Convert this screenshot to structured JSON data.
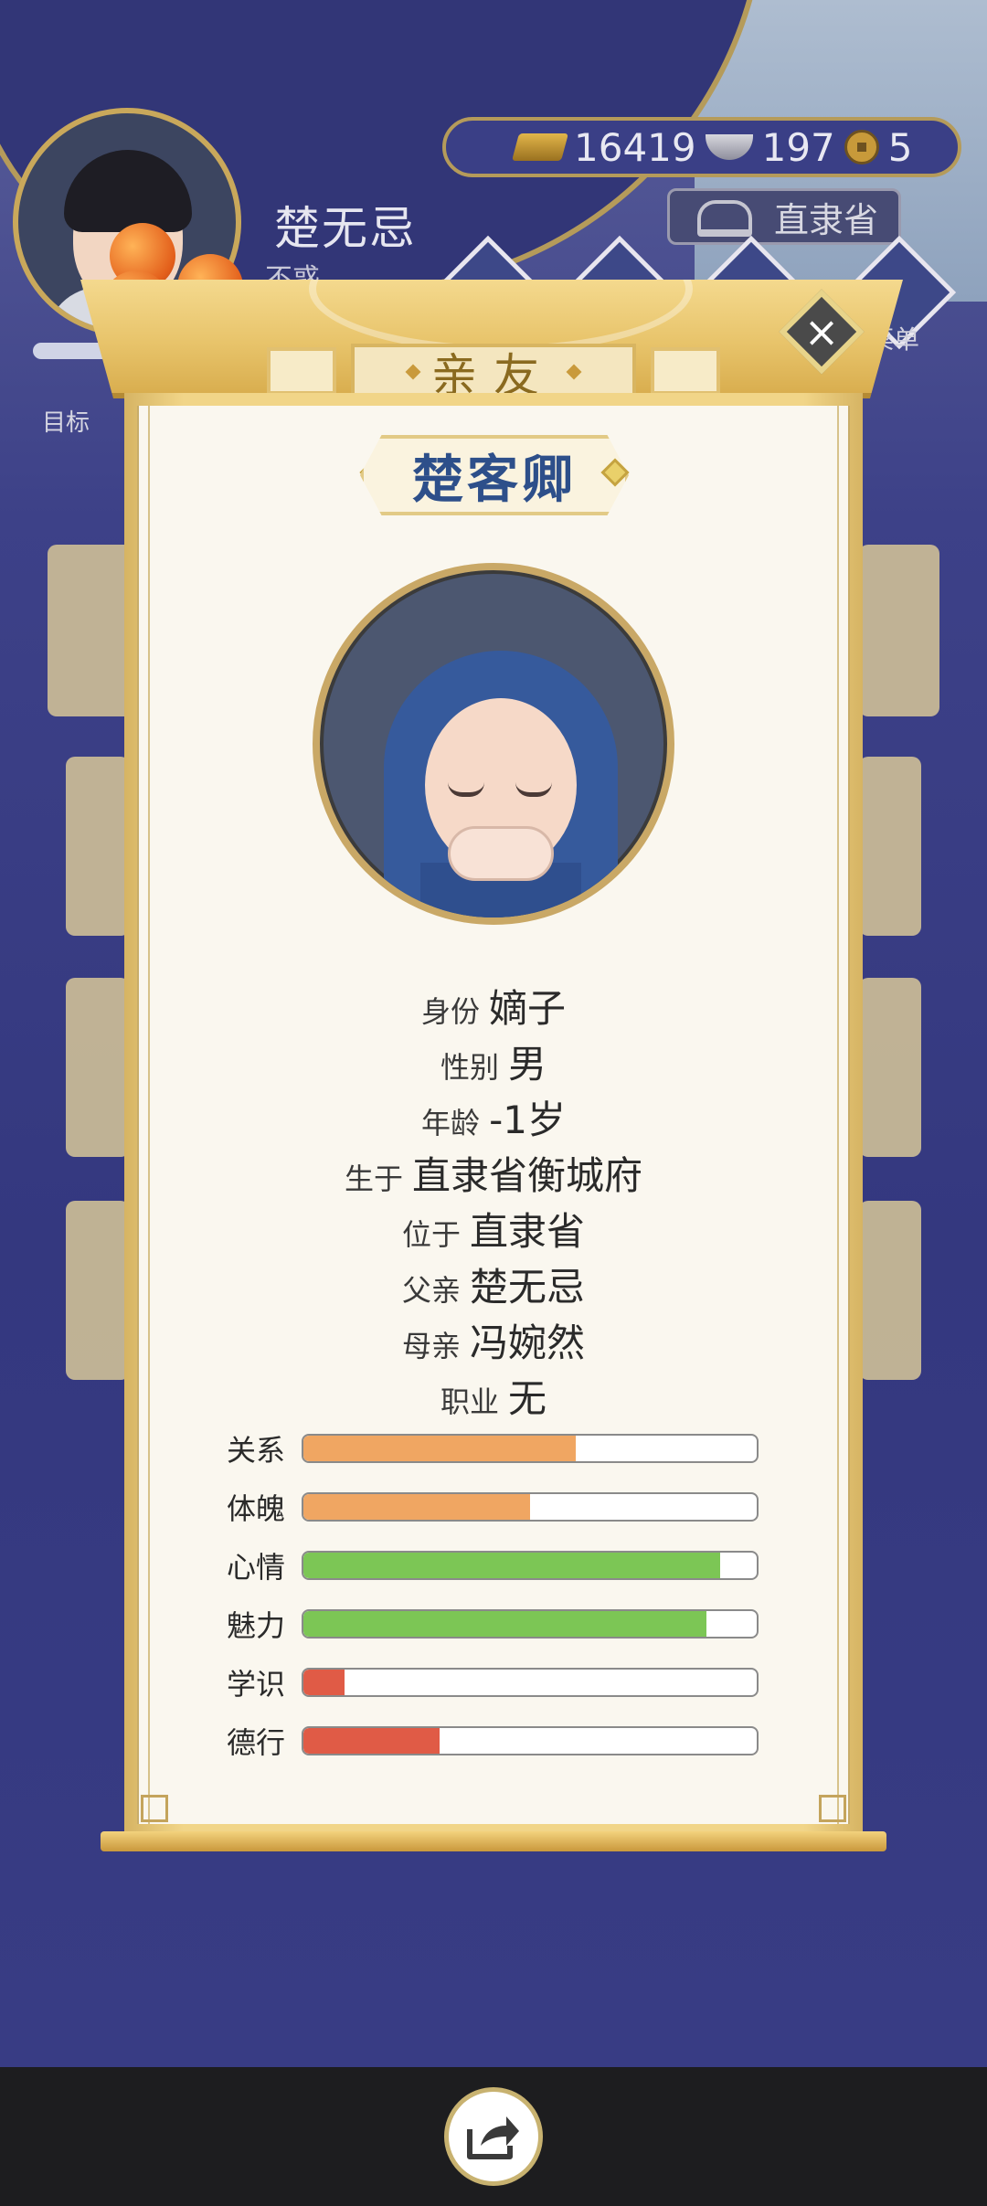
{
  "hud": {
    "player_name": "楚无忌",
    "player_age_label": "不惑",
    "target_label": "目标",
    "currency": {
      "gold": "16419",
      "silver": "197",
      "coin": "5"
    },
    "location": "直隶省",
    "menu_label": "菜单"
  },
  "modal": {
    "title": "亲友",
    "close_icon": "close-x",
    "person_name": "楚客卿",
    "info": [
      {
        "key": "身份",
        "value": "嫡子"
      },
      {
        "key": "性别",
        "value": "男"
      },
      {
        "key": "年龄",
        "value": "-1岁"
      },
      {
        "key": "生于",
        "value": "直隶省衡城府"
      },
      {
        "key": "位于",
        "value": "直隶省"
      },
      {
        "key": "父亲",
        "value": "楚无忌"
      },
      {
        "key": "母亲",
        "value": "冯婉然"
      },
      {
        "key": "职业",
        "value": "无"
      }
    ],
    "stats": [
      {
        "label": "关系",
        "value": 0.6,
        "color": "#f0a662"
      },
      {
        "label": "体魄",
        "value": 0.5,
        "color": "#f0a662"
      },
      {
        "label": "心情",
        "value": 0.92,
        "color": "#7cc655"
      },
      {
        "label": "魅力",
        "value": 0.89,
        "color": "#7cc655"
      },
      {
        "label": "学识",
        "value": 0.09,
        "color": "#e05b46"
      },
      {
        "label": "德行",
        "value": 0.3,
        "color": "#e05b46"
      }
    ]
  },
  "bottom": {
    "share_icon": "share-icon"
  }
}
